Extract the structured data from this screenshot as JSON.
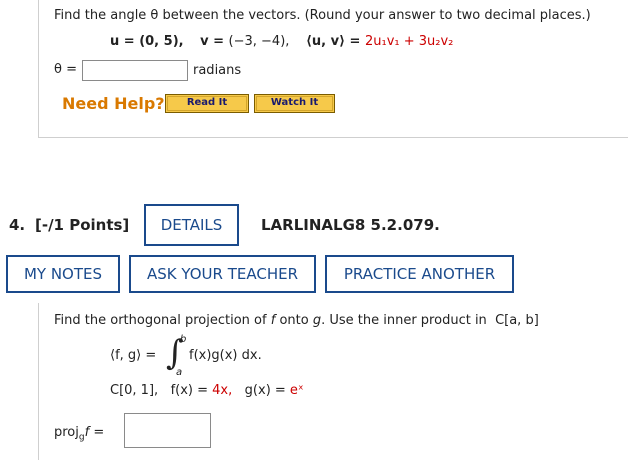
{
  "q3": {
    "prompt": "Find the angle θ between the vectors. (Round your answer to two decimal places.)",
    "u_def": "u = (0, 5),",
    "v_label": "v = ",
    "v_value": "(−3, −4),",
    "ip_left": "⟨u, v⟩ = ",
    "ip_right": "2u₁v₁ + 3u₂v₂",
    "theta_label": "θ =",
    "answer_value": "",
    "units": "radians",
    "need_help": "Need Help?",
    "read_it": "Read It",
    "watch_it": "Watch It"
  },
  "q4": {
    "number": "4.",
    "points": "[-/1 Points]",
    "details": "DETAILS",
    "code": "LARLINALG8 5.2.079.",
    "my_notes": "MY NOTES",
    "ask_teacher": "ASK YOUR TEACHER",
    "practice_another": "PRACTICE ANOTHER",
    "prompt_pre": "Find the orthogonal projection of",
    "f": "f",
    "onto": "onto",
    "g": "g",
    "prompt_post": ". Use the inner product in",
    "space": "C[a, b]",
    "ip_lhs": "⟨f, g⟩ = ",
    "int_upper": "b",
    "int_lower": "a",
    "integrand": "f(x)g(x) dx.",
    "interval": "C[0, 1],",
    "fx_label": "f(x) = ",
    "fx_value": "4x,",
    "gx_label": "g(x) = ",
    "gx_value": "eˣ",
    "proj_label": "proj",
    "proj_sub": "g",
    "proj_var": "f",
    "proj_eq": " =",
    "proj_value": ""
  }
}
